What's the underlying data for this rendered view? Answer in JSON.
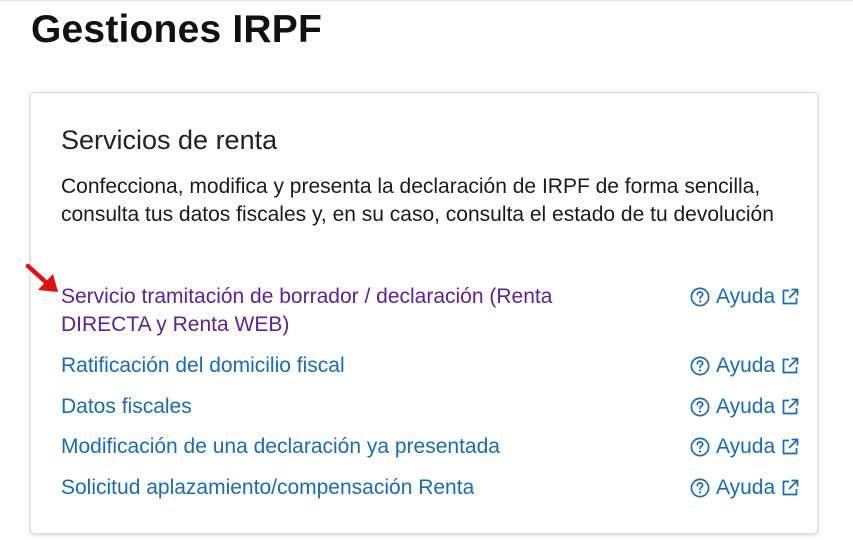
{
  "page": {
    "title": "Gestiones IRPF"
  },
  "card": {
    "title": "Servicios de renta",
    "description": "Confecciona, modifica y presenta la declaración de IRPF de forma sencilla, consulta tus datos fiscales y, en su caso, consulta el estado de tu devolución",
    "links": [
      {
        "label": "Servicio tramitación de borrador / declaración (Renta DIRECTA y Renta WEB)",
        "help_label": "Ayuda",
        "visited": true
      },
      {
        "label": "Ratificación del domicilio fiscal",
        "help_label": "Ayuda",
        "visited": false
      },
      {
        "label": "Datos fiscales",
        "help_label": "Ayuda",
        "visited": false
      },
      {
        "label": "Modificación de una declaración ya presentada",
        "help_label": "Ayuda",
        "visited": false
      },
      {
        "label": "Solicitud aplazamiento/compensación Renta",
        "help_label": "Ayuda",
        "visited": false
      }
    ]
  },
  "colors": {
    "link": "#1a6bb0",
    "visited_link": "#5b2398",
    "annotation_arrow": "#e01010"
  },
  "icons": {
    "help": "question-circle-icon",
    "external": "external-link-icon",
    "annotation": "red-arrow-icon"
  }
}
